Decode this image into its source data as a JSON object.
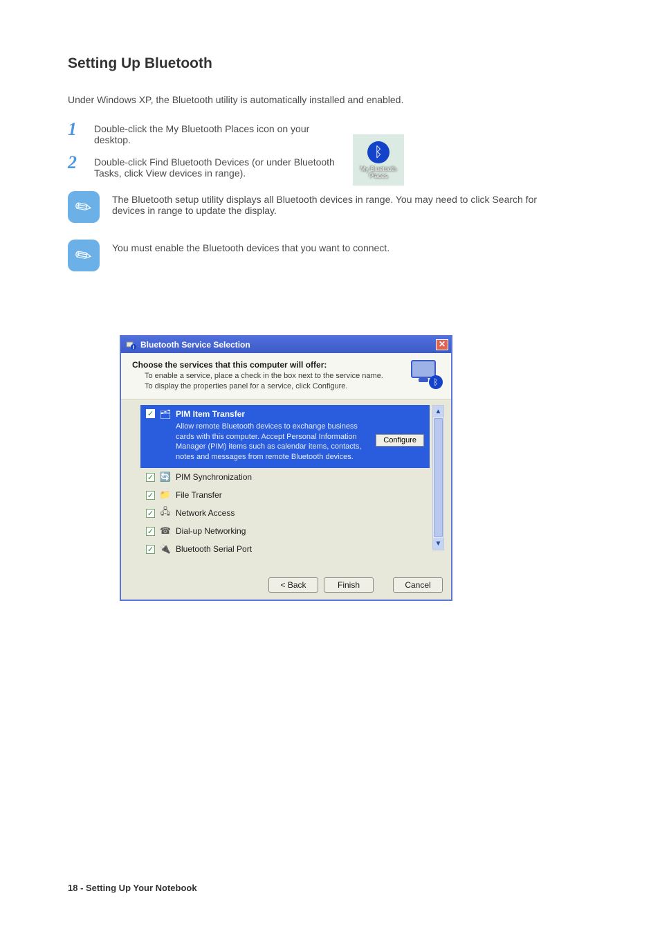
{
  "page": {
    "section_title": "Setting Up Bluetooth",
    "intro": "Under Windows XP, the Bluetooth utility is automatically installed and enabled.",
    "bt_desktop_icon": {
      "line1": "My Bluetooth",
      "line2": "Places",
      "semantic": "bluetooth-icon"
    },
    "steps": [
      {
        "num": "1",
        "text": "Double-click the My Bluetooth Places icon on your desktop."
      },
      {
        "num": "2",
        "text": "Double-click Find Bluetooth Devices (or under Bluetooth Tasks, click View devices in range)."
      }
    ],
    "notes": [
      "The Bluetooth setup utility displays all Bluetooth devices in range. You may need to click Search for devices in range to update the display.",
      "You must enable the Bluetooth devices that you want to connect."
    ],
    "footnote": "18 - Setting Up Your Notebook"
  },
  "dialog": {
    "title": "Bluetooth Service Selection",
    "close_glyph": "✕",
    "head_strong": "Choose the services that this computer will offer:",
    "head_sub": "To enable a service, place a check in the box next to the service name.\nTo display the properties panel for a service, click Configure.",
    "selected": {
      "title": "PIM Item Transfer",
      "desc": "Allow remote Bluetooth devices to exchange business cards with this computer. Accept Personal Information Manager (PIM) items such as calendar items, contacts, notes and messages from remote Bluetooth devices.",
      "configure_label": "Configure",
      "checked": true,
      "icon_glyph": "🗂"
    },
    "services": [
      {
        "label": "PIM Synchronization",
        "checked": true,
        "icon_glyph": "🔄"
      },
      {
        "label": "File Transfer",
        "checked": true,
        "icon_glyph": "📁"
      },
      {
        "label": "Network Access",
        "checked": true,
        "icon_glyph": "🖧"
      },
      {
        "label": "Dial-up Networking",
        "checked": true,
        "icon_glyph": "☎"
      },
      {
        "label": "Bluetooth Serial Port",
        "checked": true,
        "icon_glyph": "🔌"
      }
    ],
    "scroll": {
      "up": "▲",
      "down": "▼"
    },
    "buttons": {
      "back": "< Back",
      "finish": "Finish",
      "cancel": "Cancel"
    }
  }
}
